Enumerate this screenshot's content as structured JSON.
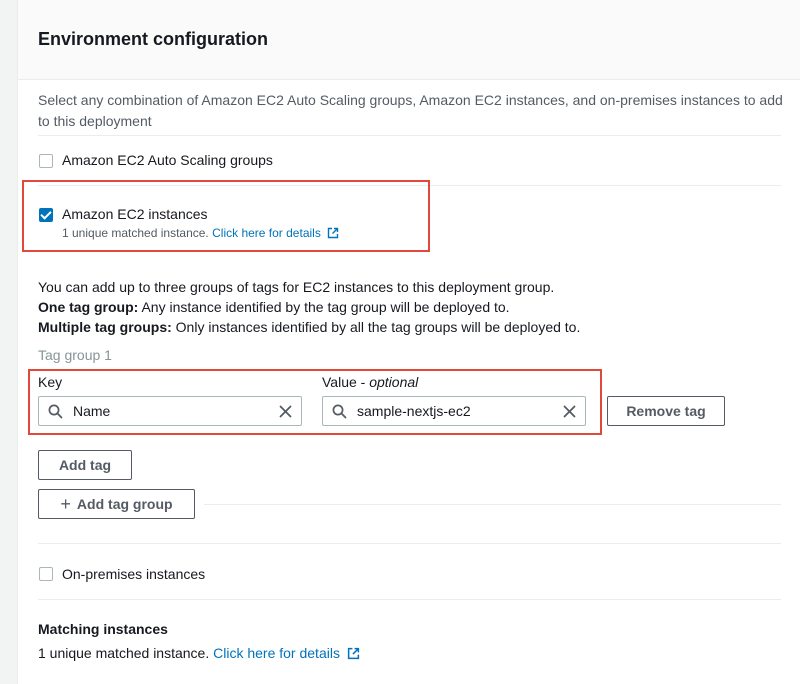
{
  "section": {
    "title": "Environment configuration",
    "description": "Select any combination of Amazon EC2 Auto Scaling groups, Amazon EC2 instances, and on-premises instances to add to this deployment"
  },
  "options": {
    "asg": {
      "label": "Amazon EC2 Auto Scaling groups",
      "checked": false
    },
    "ec2": {
      "label": "Amazon EC2 instances",
      "checked": true,
      "matched_text": "1 unique matched instance.",
      "details_link": "Click here for details"
    },
    "onprem": {
      "label": "On-premises instances",
      "checked": false
    }
  },
  "tags_info": {
    "line1": "You can add up to three groups of tags for EC2 instances to this deployment group.",
    "line2_bold": "One tag group:",
    "line2_rest": " Any instance identified by the tag group will be deployed to.",
    "line3_bold": "Multiple tag groups:",
    "line3_rest": " Only instances identified by all the tag groups will be deployed to."
  },
  "tag_group": {
    "label": "Tag group 1",
    "key_label": "Key",
    "value_label": "Value - ",
    "value_label_optional": "optional",
    "key_value": "Name",
    "value_value": "sample-nextjs-ec2",
    "remove_tag": "Remove tag",
    "add_tag": "Add tag",
    "add_tag_group": "Add tag group"
  },
  "matching": {
    "title": "Matching instances",
    "text": "1 unique matched instance.",
    "link": "Click here for details"
  },
  "colors": {
    "link": "#0073bb",
    "highlight": "#e0483a",
    "checkbox": "#0073bb"
  },
  "icons": [
    "search-icon",
    "clear-icon",
    "external-link-icon",
    "plus-icon",
    "checkmark-icon"
  ]
}
